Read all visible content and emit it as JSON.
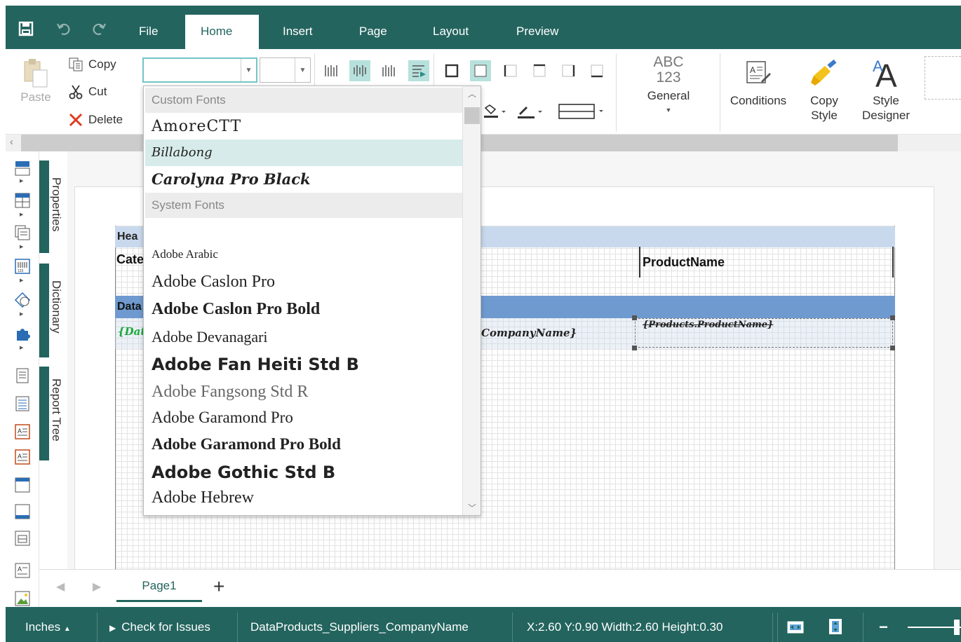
{
  "menu": {
    "tabs": [
      {
        "label": "File"
      },
      {
        "label": "Home"
      },
      {
        "label": "Insert"
      },
      {
        "label": "Page"
      },
      {
        "label": "Layout"
      },
      {
        "label": "Preview"
      }
    ],
    "active_tab": "Home"
  },
  "ribbon": {
    "paste_label": "Paste",
    "copy_label": "Copy",
    "cut_label": "Cut",
    "delete_label": "Delete",
    "font_name_value": "",
    "font_size_value": "",
    "format_line1": "ABC",
    "format_line2": "123",
    "format_label": "General",
    "conditions_label": "Conditions",
    "copy_style_line1": "Copy",
    "copy_style_line2": "Style",
    "style_designer_line1": "Style",
    "style_designer_line2": "Designer"
  },
  "side_panels": {
    "properties": "Properties",
    "dictionary": "Dictionary",
    "report_tree": "Report Tree"
  },
  "report": {
    "header_band": "Hea",
    "header_field_left": "Cate",
    "header_field_right": "ProductName",
    "data_band": "Data",
    "data_field_left": "{Dat",
    "data_field_mid": "CompanyName}",
    "data_field_right": "{Products.ProductName}"
  },
  "font_dropdown": {
    "custom_group": "Custom Fonts",
    "custom_fonts": [
      "AmoreCTT",
      "Billabong",
      "Carolyna Pro Black"
    ],
    "highlighted": "Billabong",
    "system_group": "System Fonts",
    "system_fonts": [
      "Adobe Arabic",
      "Adobe Caslon Pro",
      "Adobe Caslon Pro Bold",
      "Adobe Devanagari",
      "Adobe Fan Heiti Std B",
      "Adobe Fangsong Std R",
      "Adobe Garamond Pro",
      "Adobe Garamond Pro Bold",
      "Adobe Gothic Std B",
      "Adobe Hebrew"
    ]
  },
  "pages": {
    "tabs": [
      "Page1"
    ],
    "add_label": "+"
  },
  "status": {
    "units": "Inches",
    "check_issues": "Check for Issues",
    "component": "DataProducts_Suppliers_CompanyName",
    "geometry": "X:2.60 Y:0.90 Width:2.60 Height:0.30",
    "zoom_out": "−"
  },
  "colors": {
    "accent": "#23645e",
    "highlight": "#d7ecea",
    "band_header": "#c9d9ed",
    "band_data": "#6f9ad0"
  }
}
